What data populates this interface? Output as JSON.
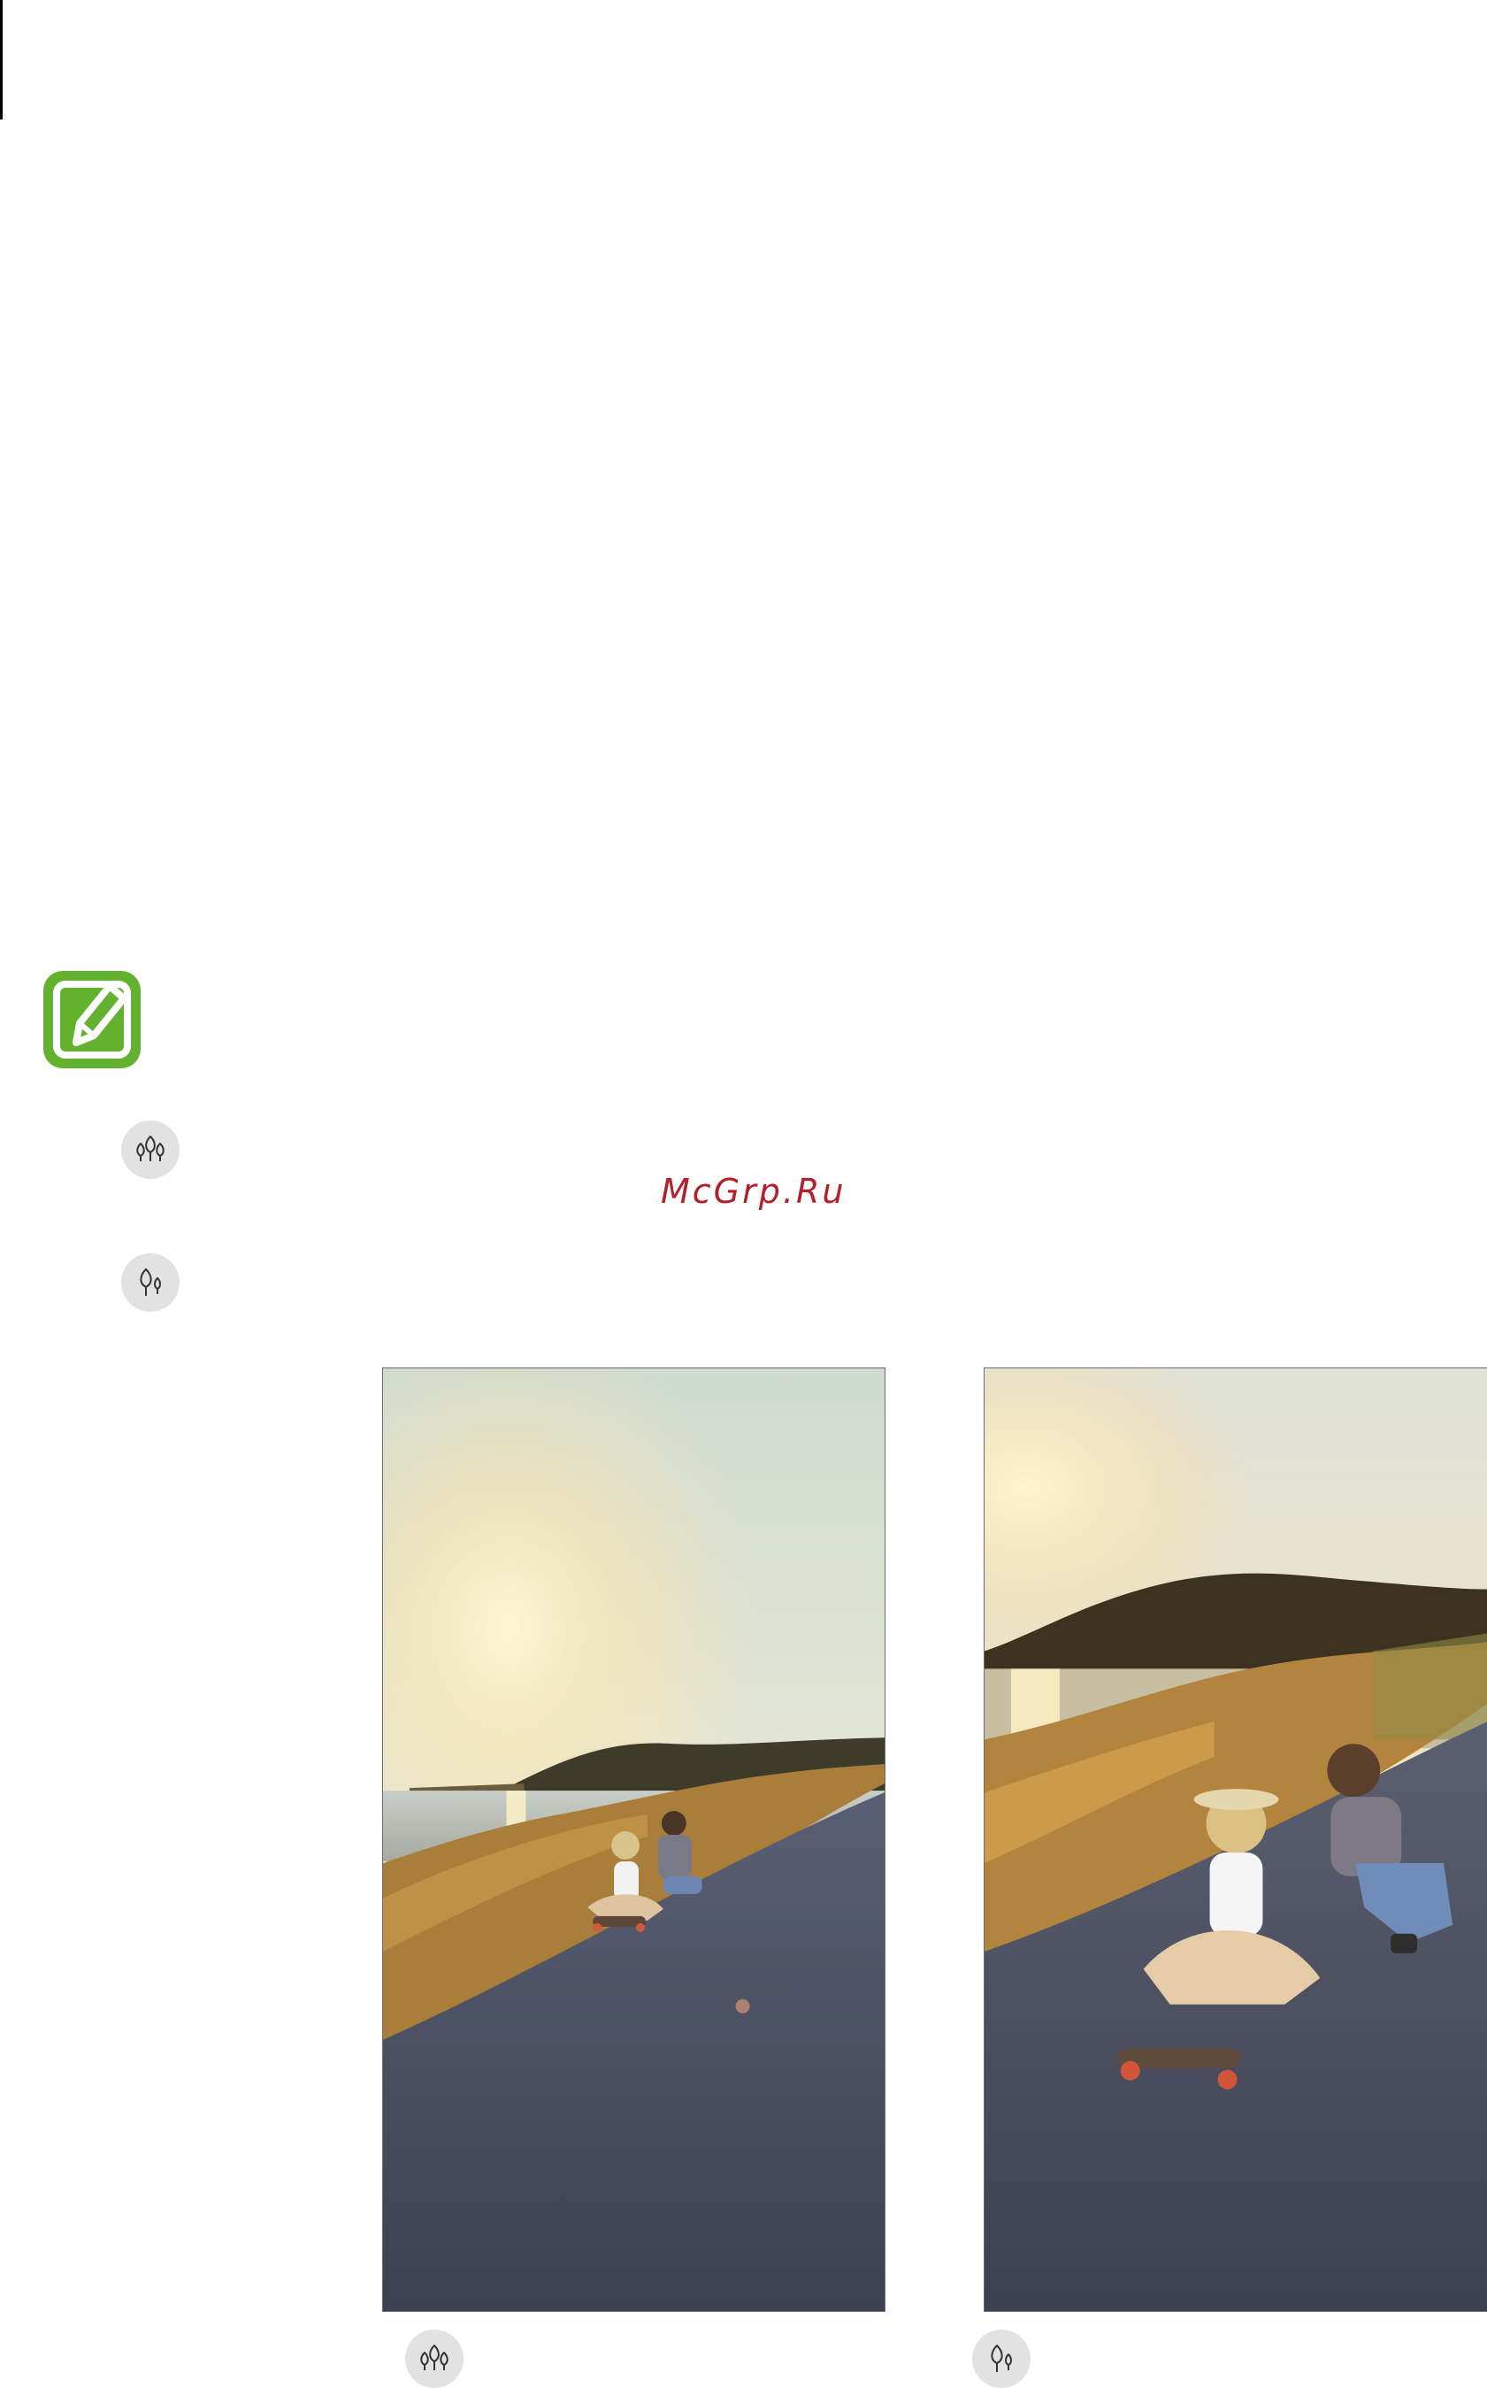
{
  "watermark": "McGrp.Ru",
  "icons": {
    "note": "note-pencil-icon",
    "wide_angle": "wide-angle-lens-icon",
    "normal": "normal-lens-icon"
  },
  "colors": {
    "note_green": "#62b22f",
    "watermark_red": "#b3202a",
    "icon_bg": "#e2e2e2"
  }
}
